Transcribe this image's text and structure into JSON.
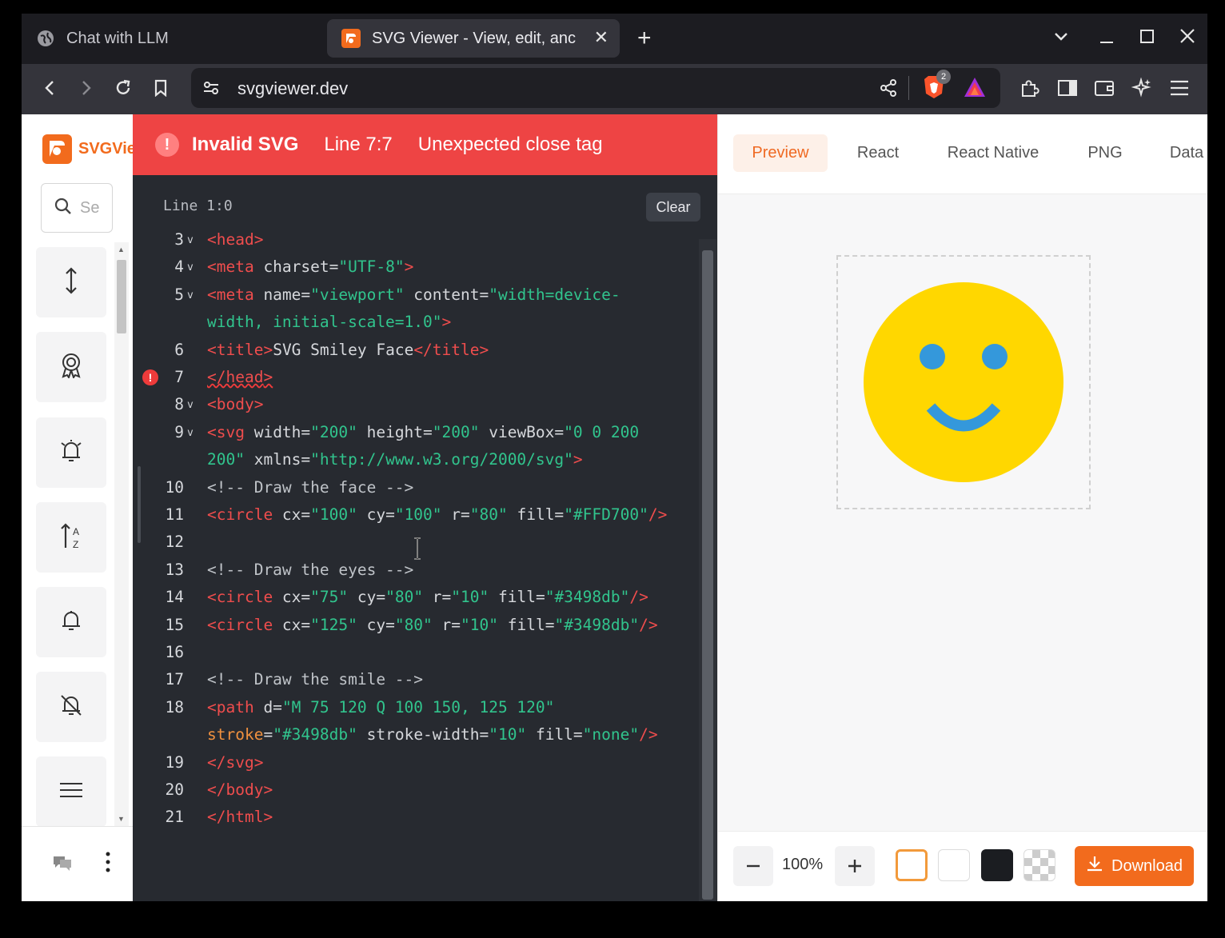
{
  "browser": {
    "tabs": [
      {
        "title": "Chat with LLM",
        "active": false
      },
      {
        "title": "SVG Viewer - View, edit, anc",
        "active": true
      }
    ],
    "url": "svgviewer.dev",
    "shield_count": "2"
  },
  "sidebar": {
    "logo_text": "SVGVie",
    "search_placeholder": "Se",
    "tools": [
      "arrows-vertical-icon",
      "award-icon",
      "alarm-icon",
      "sort-az-icon",
      "bell-icon",
      "bell-off-icon",
      "menu-icon"
    ]
  },
  "editor": {
    "error": {
      "title": "Invalid SVG",
      "position": "Line 7:7",
      "message": "Unexpected close tag"
    },
    "cursor_status": "Line 1:0",
    "clear_label": "Clear",
    "lines": [
      {
        "n": "3",
        "fold": true,
        "text": "<head>"
      },
      {
        "n": "4",
        "fold": true,
        "text": "<meta charset=\"UTF-8\">"
      },
      {
        "n": "5",
        "fold": true,
        "text": "<meta name=\"viewport\" content=\"width=device-",
        "cont": "width, initial-scale=1.0\">"
      },
      {
        "n": "6",
        "fold": false,
        "text": "<title>SVG Smiley Face</title>"
      },
      {
        "n": "7",
        "fold": false,
        "error": true,
        "text": "</head>"
      },
      {
        "n": "8",
        "fold": true,
        "text": "<body>"
      },
      {
        "n": "9",
        "fold": true,
        "text": "<svg width=\"200\" height=\"200\" viewBox=\"0 0 200",
        "cont": "200\" xmlns=\"http://www.w3.org/2000/svg\">"
      },
      {
        "n": "10",
        "fold": false,
        "text": "<!-- Draw the face -->"
      },
      {
        "n": "11",
        "fold": false,
        "text": "<circle cx=\"100\" cy=\"100\" r=\"80\" fill=\"#FFD700\"/>"
      },
      {
        "n": "12",
        "fold": false,
        "text": ""
      },
      {
        "n": "13",
        "fold": false,
        "text": "<!-- Draw the eyes -->"
      },
      {
        "n": "14",
        "fold": false,
        "text": "<circle cx=\"75\" cy=\"80\" r=\"10\" fill=\"#3498db\"/>"
      },
      {
        "n": "15",
        "fold": false,
        "text": "<circle cx=\"125\" cy=\"80\" r=\"10\" fill=\"#3498db\"/>"
      },
      {
        "n": "16",
        "fold": false,
        "text": ""
      },
      {
        "n": "17",
        "fold": false,
        "text": "<!-- Draw the smile -->"
      },
      {
        "n": "18",
        "fold": false,
        "text": "<path d=\"M 75 120 Q 100 150, 125 120\"",
        "cont": "stroke=\"#3498db\" stroke-width=\"10\" fill=\"none\"/>"
      },
      {
        "n": "19",
        "fold": false,
        "text": "</svg>"
      },
      {
        "n": "20",
        "fold": false,
        "text": "</body>"
      },
      {
        "n": "21",
        "fold": false,
        "text": "</html>"
      }
    ]
  },
  "preview": {
    "tabs": [
      "Preview",
      "React",
      "React Native",
      "PNG",
      "Data"
    ],
    "selected_tab": "Preview",
    "zoom": "100%",
    "download_label": "Download",
    "smiley": {
      "face_color": "#FFD700",
      "feature_color": "#3498db"
    },
    "backgrounds": [
      "transparent-orange-outline",
      "white",
      "black",
      "checkerboard"
    ]
  },
  "colors": {
    "accent": "#f26b1d",
    "error": "#ee4444",
    "editor_bg": "#272a30"
  }
}
